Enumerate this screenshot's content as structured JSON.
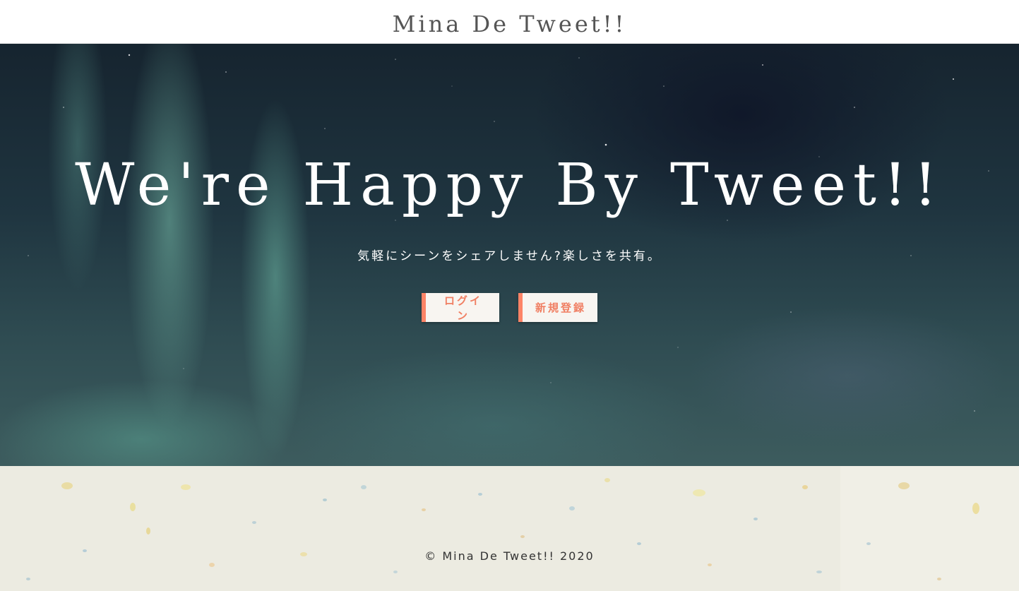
{
  "header": {
    "brand": "Mina De Tweet!!"
  },
  "hero": {
    "title": "We're Happy By Tweet!!",
    "subtitle": "気軽にシーンをシェアしません?楽しさを共有。",
    "buttons": {
      "login_label": "ログイン",
      "signup_label": "新規登録"
    }
  },
  "footer": {
    "copyright": "© Mina De Tweet!! 2020"
  },
  "colors": {
    "accent": "#fd8467",
    "button_bg": "#f8f5f1",
    "hero_text": "#ffffff",
    "brand_text": "#555555",
    "footer_bg": "#ecebe1"
  }
}
